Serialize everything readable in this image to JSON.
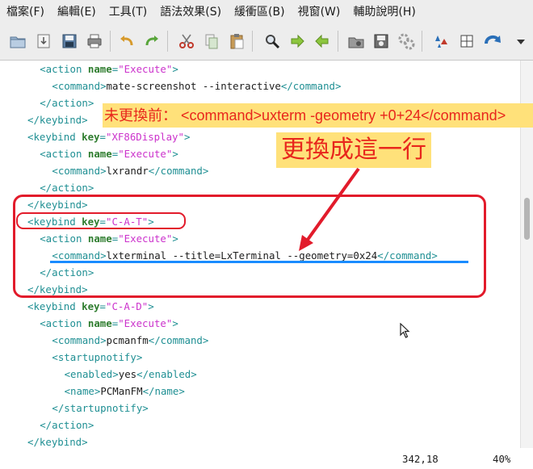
{
  "menubar": {
    "items": [
      {
        "label": "檔案(F)"
      },
      {
        "label": "編輯(E)"
      },
      {
        "label": "工具(T)"
      },
      {
        "label": "語法效果(S)"
      },
      {
        "label": "緩衝區(B)"
      },
      {
        "label": "視窗(W)"
      },
      {
        "label": "輔助說明(H)"
      }
    ]
  },
  "toolbar": {
    "icons": [
      "open-icon",
      "save-download-icon",
      "save-icon",
      "print-icon",
      "undo-icon",
      "redo-icon",
      "cut-icon",
      "copy-icon",
      "paste-icon",
      "find-replace-icon",
      "forward-icon",
      "back-icon",
      "load-session-icon",
      "save-session-icon",
      "run-script-icon",
      "make-icon",
      "diff-icon",
      "table-icon",
      "jump-icon",
      "dropdown-icon"
    ]
  },
  "editor": {
    "lines": [
      {
        "indent": "  ",
        "parts": [
          [
            "tg",
            "<action "
          ],
          [
            "at",
            "name"
          ],
          [
            "tg",
            "="
          ],
          [
            "st",
            "\"Execute\""
          ],
          [
            "tg",
            ">"
          ]
        ]
      },
      {
        "indent": "    ",
        "parts": [
          [
            "tg",
            "<command>"
          ],
          [
            "tx",
            "mate-screenshot --interactive"
          ],
          [
            "tg",
            "</command>"
          ]
        ]
      },
      {
        "indent": "  ",
        "parts": [
          [
            "tg",
            "</action>"
          ]
        ]
      },
      {
        "indent": "",
        "parts": [
          [
            "tg",
            "</keybind>"
          ]
        ]
      },
      {
        "indent": "",
        "parts": [
          [
            "tg",
            "<keybind "
          ],
          [
            "at",
            "key"
          ],
          [
            "tg",
            "="
          ],
          [
            "st",
            "\"XF86Display\""
          ],
          [
            "tg",
            ">"
          ]
        ]
      },
      {
        "indent": "  ",
        "parts": [
          [
            "tg",
            "<action "
          ],
          [
            "at",
            "name"
          ],
          [
            "tg",
            "="
          ],
          [
            "st",
            "\"Execute\""
          ],
          [
            "tg",
            ">"
          ]
        ]
      },
      {
        "indent": "    ",
        "parts": [
          [
            "tg",
            "<command>"
          ],
          [
            "tx",
            "lxrandr"
          ],
          [
            "tg",
            "</command>"
          ]
        ]
      },
      {
        "indent": "  ",
        "parts": [
          [
            "tg",
            "</action>"
          ]
        ]
      },
      {
        "indent": "",
        "parts": [
          [
            "tg",
            "</keybind>"
          ]
        ]
      },
      {
        "indent": "",
        "parts": [
          [
            "tg",
            "<keybind "
          ],
          [
            "at",
            "key"
          ],
          [
            "tg",
            "="
          ],
          [
            "st",
            "\"C-A-T\""
          ],
          [
            "tg",
            ">"
          ]
        ]
      },
      {
        "indent": "  ",
        "parts": [
          [
            "tg",
            "<action "
          ],
          [
            "at",
            "name"
          ],
          [
            "tg",
            "="
          ],
          [
            "st",
            "\"Execute\""
          ],
          [
            "tg",
            ">"
          ]
        ]
      },
      {
        "indent": "    ",
        "parts": [
          [
            "tg",
            "<command>"
          ],
          [
            "tx",
            "lxterminal --title=LxTerminal --geometry=0x24"
          ],
          [
            "tg",
            "</command>"
          ]
        ]
      },
      {
        "indent": "  ",
        "parts": [
          [
            "tg",
            "</action>"
          ]
        ]
      },
      {
        "indent": "",
        "parts": [
          [
            "tg",
            "</keybind>"
          ]
        ]
      },
      {
        "indent": "",
        "parts": [
          [
            "tg",
            "<keybind "
          ],
          [
            "at",
            "key"
          ],
          [
            "tg",
            "="
          ],
          [
            "st",
            "\"C-A-D\""
          ],
          [
            "tg",
            ">"
          ]
        ]
      },
      {
        "indent": "  ",
        "parts": [
          [
            "tg",
            "<action "
          ],
          [
            "at",
            "name"
          ],
          [
            "tg",
            "="
          ],
          [
            "st",
            "\"Execute\""
          ],
          [
            "tg",
            ">"
          ]
        ]
      },
      {
        "indent": "    ",
        "parts": [
          [
            "tg",
            "<command>"
          ],
          [
            "tx",
            "pcmanfm"
          ],
          [
            "tg",
            "</command>"
          ]
        ]
      },
      {
        "indent": "    ",
        "parts": [
          [
            "tg",
            "<startupnotify>"
          ]
        ]
      },
      {
        "indent": "      ",
        "parts": [
          [
            "tg",
            "<enabled>"
          ],
          [
            "tx",
            "yes"
          ],
          [
            "tg",
            "</enabled>"
          ]
        ]
      },
      {
        "indent": "      ",
        "parts": [
          [
            "tg",
            "<name>"
          ],
          [
            "tx",
            "PCManFM"
          ],
          [
            "tg",
            "</name>"
          ]
        ]
      },
      {
        "indent": "    ",
        "parts": [
          [
            "tg",
            "</startupnotify>"
          ]
        ]
      },
      {
        "indent": "  ",
        "parts": [
          [
            "tg",
            "</action>"
          ]
        ]
      },
      {
        "indent": "",
        "parts": [
          [
            "tg",
            "</keybind>"
          ]
        ]
      }
    ]
  },
  "annotations": {
    "before_label": "未更換前： <command>uxterm -geometry +0+24</command>",
    "replace_label": "更換成這一行"
  },
  "status": {
    "position": "342,18",
    "percent": "40%"
  },
  "colors": {
    "tag": "#1f8f93",
    "attribute": "#2f7d2f",
    "string": "#cc33cc",
    "annotation_red": "#e21b2b",
    "annotation_blue": "#1a8cff",
    "highlight_yellow": "#ffe17a"
  }
}
